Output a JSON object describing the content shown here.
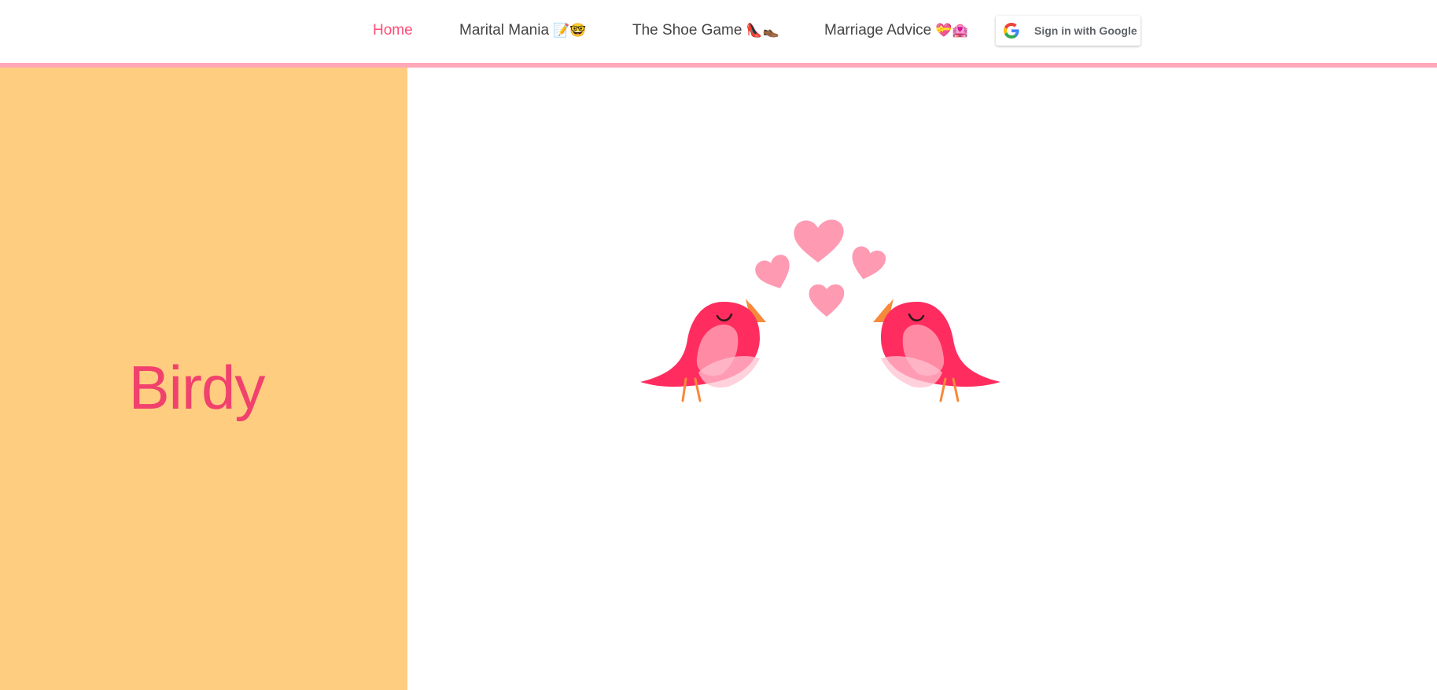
{
  "nav": {
    "items": [
      {
        "label": "Home",
        "emoji": ""
      },
      {
        "label": "Marital Mania",
        "emoji": "📝🤓"
      },
      {
        "label": "The Shoe Game",
        "emoji": "👠👞"
      },
      {
        "label": "Marriage Advice",
        "emoji": "💝🏩"
      }
    ],
    "active_index": 0
  },
  "auth": {
    "google_label": "Sign in with Google"
  },
  "brand": {
    "name": "Birdy"
  },
  "colors": {
    "accent": "#ff4d76",
    "brand_text": "#f1416d",
    "sidebar_bg": "#fecd80",
    "nav_underline": "#ffa8b8",
    "bird_body": "#ff2d5f",
    "bird_wing": "#ff8aa4",
    "heart": "#ff9ab3",
    "beak": "#f7893a"
  },
  "icons": {
    "google": "google-g-icon",
    "hero": "love-birds-illustration"
  }
}
